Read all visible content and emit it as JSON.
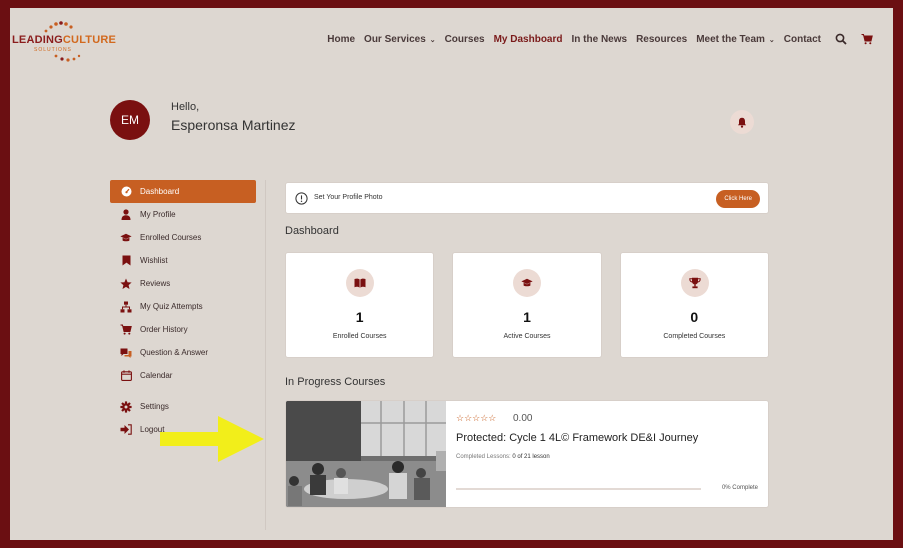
{
  "brand": {
    "logo_main_a": "LEADING",
    "logo_main_b": "CULTURE",
    "logo_sub": "SOLUTIONS",
    "colors": {
      "accent": "#c75f22",
      "brand": "#7a1010",
      "frame": "#6b0f12"
    }
  },
  "nav": {
    "items": [
      {
        "label": "Home",
        "dropdown": false,
        "active": false
      },
      {
        "label": "Our Services",
        "dropdown": true,
        "active": false
      },
      {
        "label": "Courses",
        "dropdown": false,
        "active": false
      },
      {
        "label": "My Dashboard",
        "dropdown": false,
        "active": true
      },
      {
        "label": "In the News",
        "dropdown": false,
        "active": false
      },
      {
        "label": "Resources",
        "dropdown": false,
        "active": false
      },
      {
        "label": "Meet the Team",
        "dropdown": true,
        "active": false
      },
      {
        "label": "Contact",
        "dropdown": false,
        "active": false
      }
    ],
    "icons": [
      "search-icon",
      "cart-icon"
    ]
  },
  "user": {
    "initials": "EM",
    "greeting": "Hello,",
    "name": "Esperonsa Martinez"
  },
  "sidebar": {
    "items": [
      {
        "label": "Dashboard",
        "icon": "dashboard-icon",
        "active": true
      },
      {
        "label": "My Profile",
        "icon": "user-icon",
        "active": false
      },
      {
        "label": "Enrolled Courses",
        "icon": "graduation-cap-icon",
        "active": false
      },
      {
        "label": "Wishlist",
        "icon": "bookmark-icon",
        "active": false
      },
      {
        "label": "Reviews",
        "icon": "star-icon",
        "active": false
      },
      {
        "label": "My Quiz Attempts",
        "icon": "sitemap-icon",
        "active": false
      },
      {
        "label": "Order History",
        "icon": "cart-icon",
        "active": false
      },
      {
        "label": "Question & Answer",
        "icon": "question-answer-icon",
        "active": false
      },
      {
        "label": "Calendar",
        "icon": "calendar-icon",
        "active": false
      },
      {
        "label": "Settings",
        "icon": "gear-icon",
        "active": false
      },
      {
        "label": "Logout",
        "icon": "logout-icon",
        "active": false
      }
    ]
  },
  "main": {
    "profile_prompt": "Set Your Profile Photo",
    "click_here": "Click Here",
    "dashboard_title": "Dashboard",
    "stats": [
      {
        "value": "1",
        "label": "Enrolled Courses",
        "icon": "book-icon"
      },
      {
        "value": "1",
        "label": "Active Courses",
        "icon": "graduation-cap-icon"
      },
      {
        "value": "0",
        "label": "Completed Courses",
        "icon": "trophy-icon"
      }
    ],
    "in_progress_title": "In Progress Courses",
    "course": {
      "stars": "☆☆☆☆☆",
      "rating": "0.00",
      "title": "Protected: Cycle 1 4L© Framework DE&I Journey",
      "lessons_label": "Completed Lessons:",
      "lessons_value": "0 of 21 lesson",
      "progress_fraction": 0,
      "complete_text": "0% Complete"
    }
  }
}
